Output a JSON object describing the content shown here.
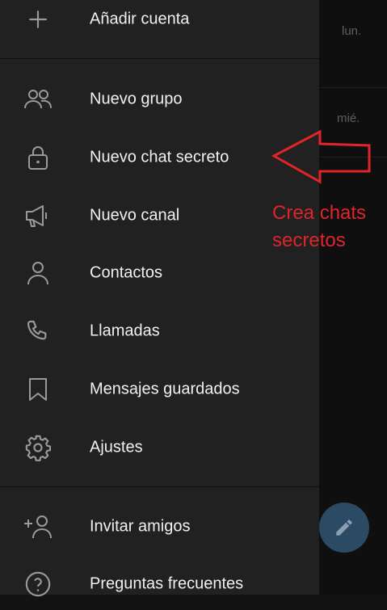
{
  "drawer": {
    "add_account": {
      "label": "Añadir cuenta",
      "icon": "plus-icon"
    },
    "items": [
      {
        "label": "Nuevo grupo",
        "icon": "group-icon"
      },
      {
        "label": "Nuevo chat secreto",
        "icon": "lock-icon"
      },
      {
        "label": "Nuevo canal",
        "icon": "megaphone-icon"
      },
      {
        "label": "Contactos",
        "icon": "person-icon"
      },
      {
        "label": "Llamadas",
        "icon": "phone-icon"
      },
      {
        "label": "Mensajes guardados",
        "icon": "bookmark-icon"
      },
      {
        "label": "Ajustes",
        "icon": "gear-icon"
      }
    ],
    "bottom_items": [
      {
        "label": "Invitar amigos",
        "icon": "add-person-icon"
      },
      {
        "label": "Preguntas frecuentes",
        "icon": "help-icon"
      }
    ]
  },
  "background_chats": [
    {
      "time": "lun."
    },
    {
      "time": "mié."
    }
  ],
  "annotation": {
    "line1": "Crea chats",
    "line2": "secretos",
    "color": "#e0242a"
  },
  "colors": {
    "drawer_bg": "#212121",
    "text": "#f1f1f1",
    "icon": "#9a9a9a",
    "fab": "#2b4a63"
  }
}
